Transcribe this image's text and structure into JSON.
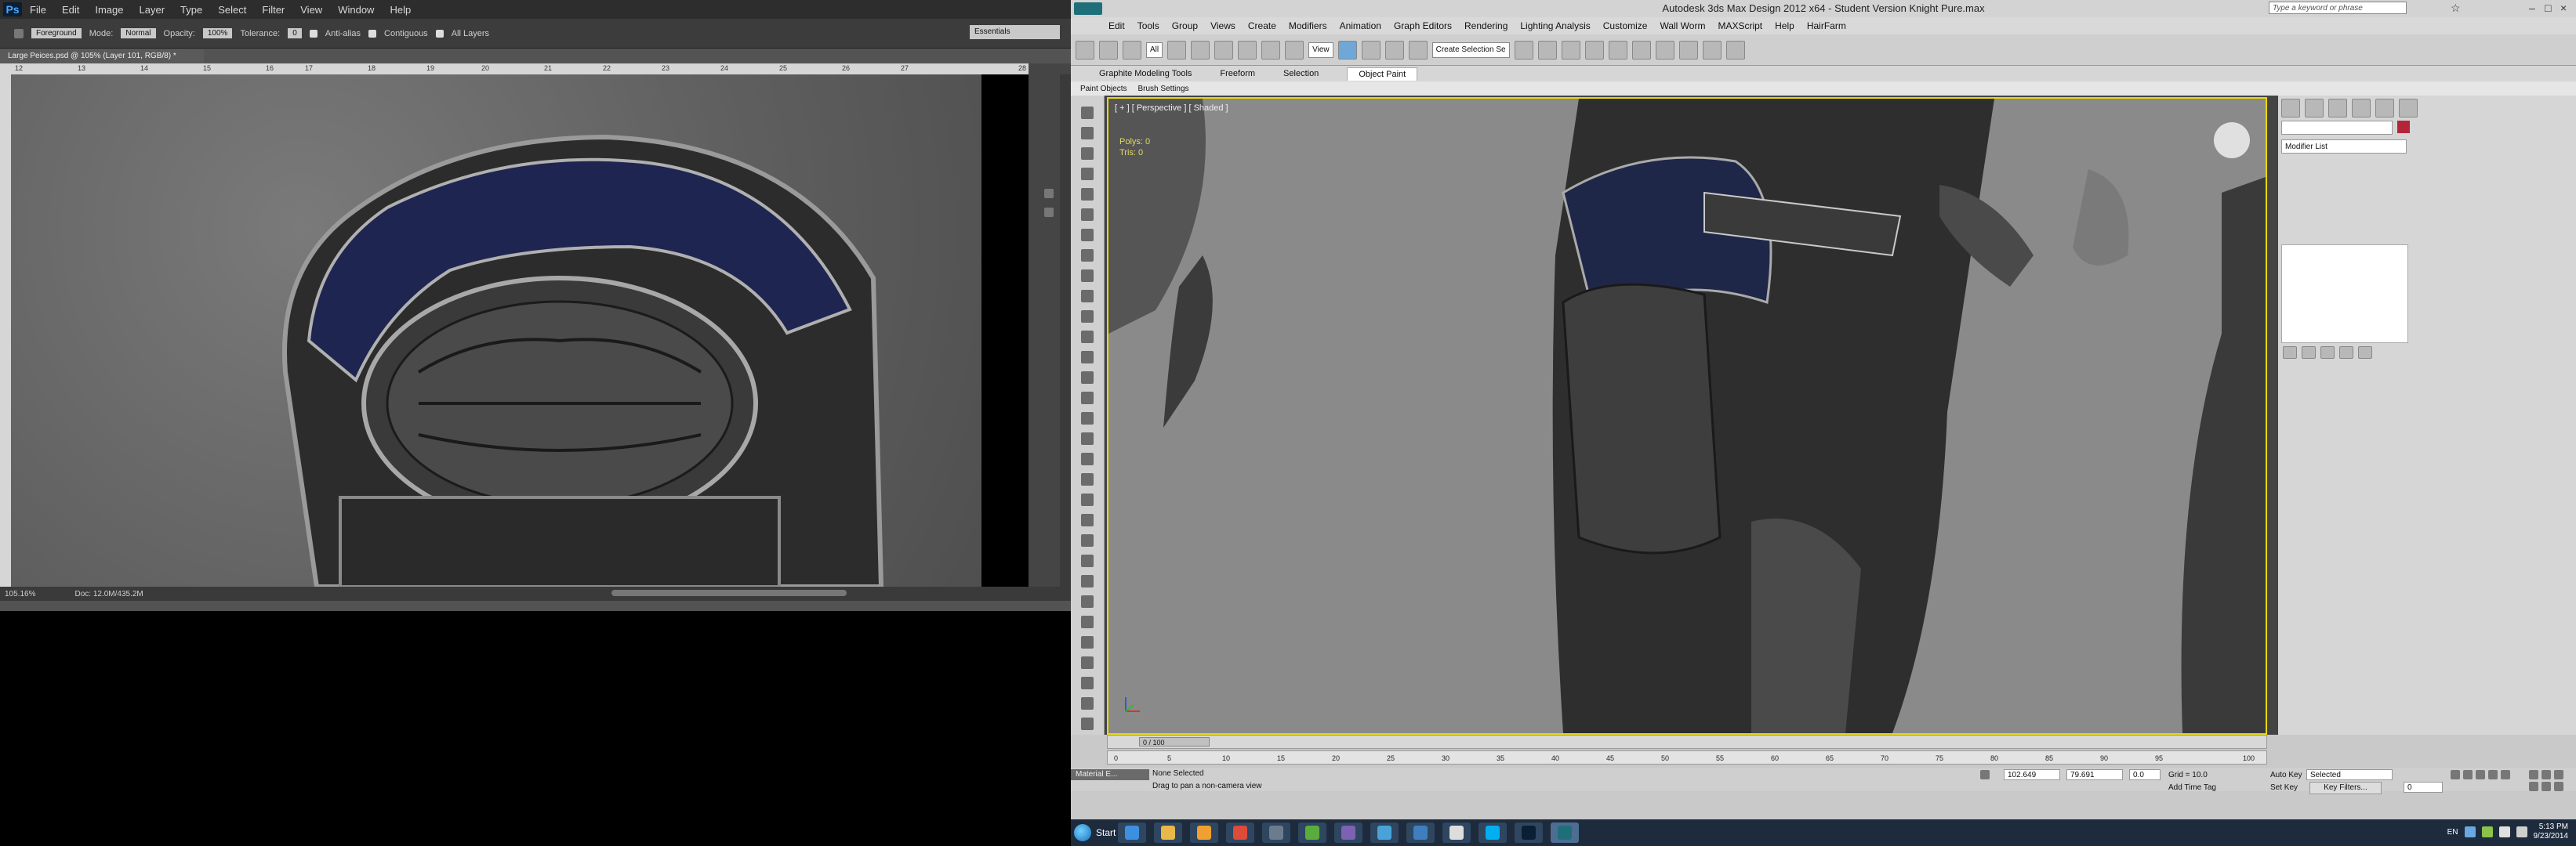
{
  "photoshop": {
    "logo": "Ps",
    "menus": [
      "File",
      "Edit",
      "Image",
      "Layer",
      "Type",
      "Select",
      "Filter",
      "View",
      "Window",
      "Help"
    ],
    "options": {
      "preset": "Foreground",
      "mode_label": "Mode:",
      "mode_value": "Normal",
      "opacity_label": "Opacity:",
      "opacity_value": "100%",
      "tolerance_label": "Tolerance:",
      "tolerance_value": "0",
      "anti_alias": "Anti-alias",
      "contiguous": "Contiguous",
      "all_layers": "All Layers"
    },
    "workspace": "Essentials",
    "doc_tab": "Large Peices.psd @ 105% (Layer 101, RGB/8) *",
    "ruler_marks": [
      "12",
      "13",
      "14",
      "15",
      "16",
      "17",
      "18",
      "19",
      "20",
      "21",
      "22",
      "23",
      "24",
      "25",
      "26",
      "27",
      "28"
    ],
    "status_zoom": "105.16%",
    "status_doc": "Doc: 12.0M/435.2M"
  },
  "max": {
    "title": "Autodesk 3ds Max Design 2012 x64  -  Student Version   Knight Pure.max",
    "search_placeholder": "Type a keyword or phrase",
    "menus": [
      "Edit",
      "Tools",
      "Group",
      "Views",
      "Create",
      "Modifiers",
      "Animation",
      "Graph Editors",
      "Rendering",
      "Lighting Analysis",
      "Customize",
      "Wall Worm",
      "MAXScript",
      "Help",
      "HairFarm"
    ],
    "toolbar": {
      "filter": "All",
      "ref_coord": "View",
      "selection_set": "Create Selection Se"
    },
    "ribbon_tabs": [
      "Graphite Modeling Tools",
      "Freeform",
      "Selection",
      "Object Paint"
    ],
    "ribbon_active": "Object Paint",
    "subribbon": [
      "Paint Objects",
      "Brush Settings"
    ],
    "viewport_label": "[ + ] [ Perspective ] [ Shaded ]",
    "viewport_stats": [
      "Polys:",
      "0",
      "Tris:",
      "0"
    ],
    "command_panel": {
      "modifier_list": "Modifier List"
    },
    "timeslider": "0 / 100",
    "track_ticks": [
      "0",
      "5",
      "10",
      "15",
      "20",
      "25",
      "30",
      "35",
      "40",
      "45",
      "50",
      "55",
      "60",
      "65",
      "70",
      "75",
      "80",
      "85",
      "90",
      "95",
      "100"
    ],
    "status": {
      "material_tab": "Material E...",
      "line1": "None Selected",
      "line2": "Drag to pan a non-camera view",
      "x": "102.649",
      "y": "79.691",
      "z": "0.0",
      "grid": "Grid = 10.0",
      "add_time_tag": "Add Time Tag",
      "auto_key": "Auto Key",
      "set_key": "Set Key",
      "selected": "Selected",
      "key_filters": "Key Filters...",
      "frame": "0"
    }
  },
  "taskbar": {
    "start": "Start",
    "apps": [
      {
        "name": "dropbox",
        "color": "#3d8fe0"
      },
      {
        "name": "explorer",
        "color": "#e8b84b"
      },
      {
        "name": "media",
        "color": "#f0a030"
      },
      {
        "name": "chrome",
        "color": "#dd4b39"
      },
      {
        "name": "steam",
        "color": "#6b7c8c"
      },
      {
        "name": "utorrent",
        "color": "#5aad3c"
      },
      {
        "name": "app-a",
        "color": "#7d62b3"
      },
      {
        "name": "network",
        "color": "#4aa3d8"
      },
      {
        "name": "ccleaner",
        "color": "#3f7fbf"
      },
      {
        "name": "gamepad",
        "color": "#dddddd"
      },
      {
        "name": "skype",
        "color": "#00aff0"
      },
      {
        "name": "photoshop",
        "color": "#0a1f33"
      },
      {
        "name": "3dsmax",
        "color": "#1f6f7a"
      }
    ],
    "lang": "EN",
    "time": "5:13 PM",
    "date": "9/23/2014"
  }
}
